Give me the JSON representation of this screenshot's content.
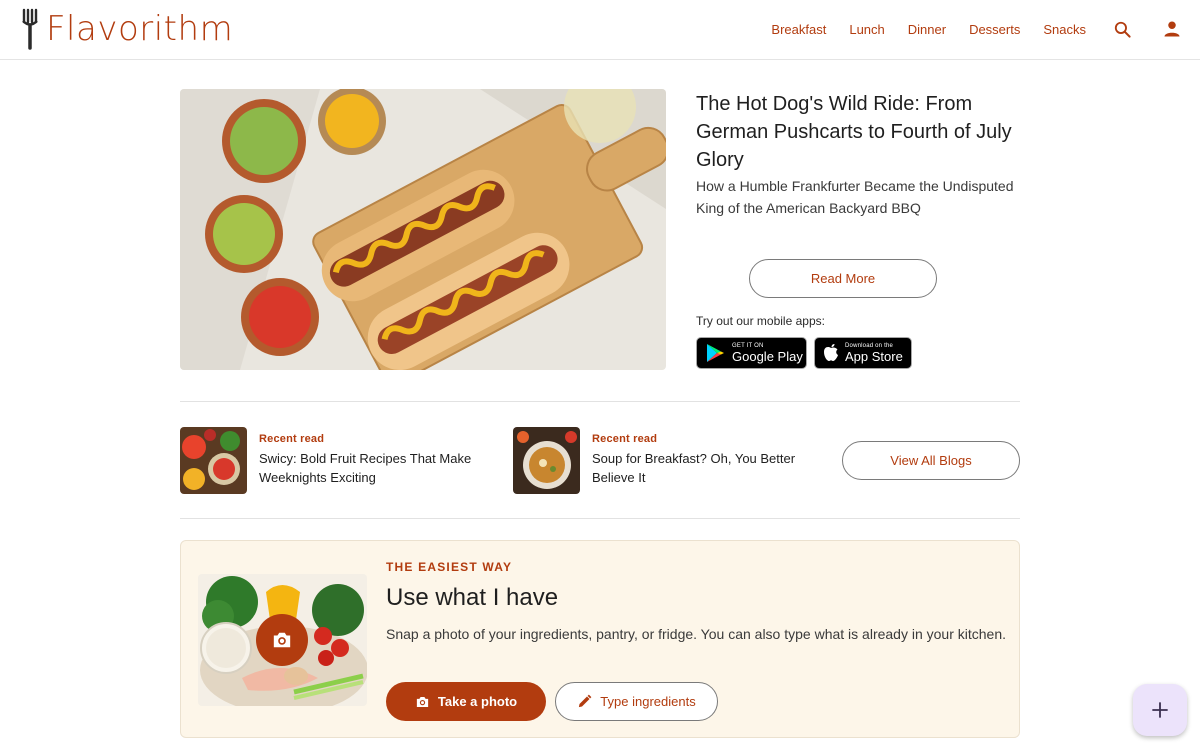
{
  "brand": {
    "name": "Flavorithm",
    "color": "#b23c0f"
  },
  "nav": {
    "items": [
      "Breakfast",
      "Lunch",
      "Dinner",
      "Desserts",
      "Snacks"
    ],
    "icons": [
      "search-icon",
      "account-icon"
    ]
  },
  "feature": {
    "title": "The Hot Dog's Wild Ride: From German Pushcarts to Fourth of July Glory",
    "subtitle": "How a Humble Frankfurter Became the Undisputed King of the American Backyard BBQ",
    "read_more": "Read More",
    "apps_label": "Try out our mobile apps:",
    "google_play": {
      "small": "GET IT ON",
      "big": "Google Play"
    },
    "app_store": {
      "small": "Download on the",
      "big": "App Store"
    }
  },
  "recent": [
    {
      "label": "Recent read",
      "title": "Swicy: Bold Fruit Recipes That Make Weeknights Exciting"
    },
    {
      "label": "Recent read",
      "title": "Soup for Breakfast? Oh, You Better Believe It"
    }
  ],
  "view_all": "View All Blogs",
  "use_card": {
    "eyebrow": "THE EASIEST WAY",
    "title": "Use what I have",
    "description": "Snap a photo of your ingredients, pantry, or fridge. You can also type what is already in your kitchen.",
    "take_photo": "Take a photo",
    "type_ingredients": "Type ingredients"
  },
  "fab": {
    "icon": "plus-icon",
    "label": "+"
  }
}
